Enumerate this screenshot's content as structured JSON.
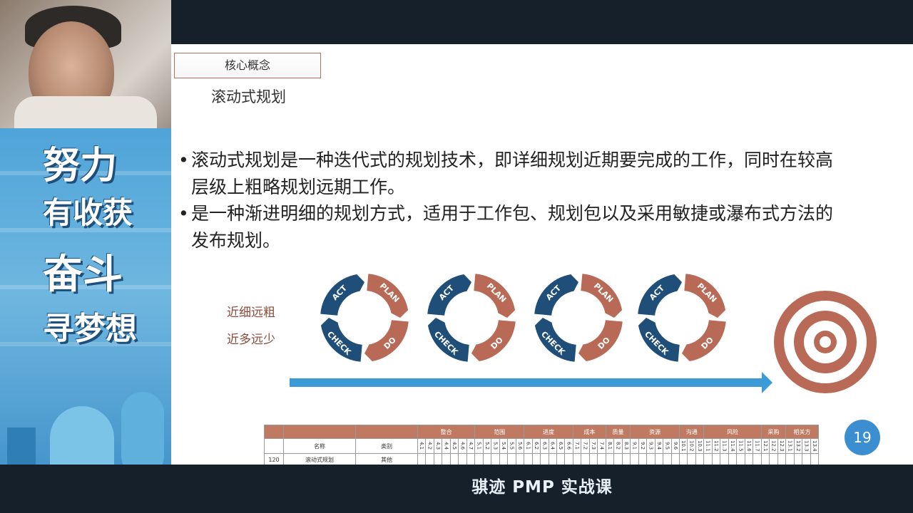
{
  "video": {
    "caption": "骐迹 PMP 实战课"
  },
  "banner": {
    "motto_1": "努力",
    "motto_2": "有收获",
    "motto_3": "奋斗",
    "motto_4": "寻梦想"
  },
  "slide": {
    "tag": "核心概念",
    "title": "滚动式规划",
    "bullets": [
      "滚动式规划是一种迭代式的规划技术，即详细规划近期要完成的工作，同时在较高层级上粗略规划远期工作。",
      "是一种渐进明细的规划方式，适用于工作包、规划包以及采用敏捷或瀑布式方法的发布规划。"
    ],
    "bullet_symbol": "•",
    "side_labels": [
      "近细远粗",
      "近多远少"
    ],
    "cycle_labels": {
      "act": "ACT",
      "plan": "PLAN",
      "do": "DO",
      "check": "CHECK"
    },
    "page_number": "19",
    "colors": {
      "blue": "#1f4e79",
      "rust": "#b86a56",
      "arrow": "#3b9bd6"
    }
  },
  "table": {
    "header_groups": [
      "整合",
      "范围",
      "进度",
      "成本",
      "质量",
      "资源",
      "沟通",
      "风险",
      "采购",
      "相关方"
    ],
    "name_header": "名称",
    "type_header": "类别",
    "row": {
      "id": "120",
      "name": "滚动式规划",
      "type": "其他"
    },
    "codes": [
      "4.1",
      "4.2",
      "4.3",
      "4.4",
      "4.5",
      "4.6",
      "4.7",
      "5.1",
      "5.2",
      "5.3",
      "5.4",
      "5.5",
      "5.6",
      "6.1",
      "6.2",
      "6.3",
      "6.4",
      "6.5",
      "6.6",
      "7.1",
      "7.2",
      "7.3",
      "7.4",
      "8.1",
      "8.2",
      "8.3",
      "9.1",
      "9.2",
      "9.3",
      "9.4",
      "9.5",
      "9.6",
      "10.1",
      "10.2",
      "10.3",
      "11.1",
      "11.2",
      "11.3",
      "11.4",
      "11.5",
      "11.6",
      "11.7",
      "12.1",
      "12.2",
      "12.3",
      "13.1",
      "13.2",
      "13.3",
      "13.4"
    ]
  }
}
